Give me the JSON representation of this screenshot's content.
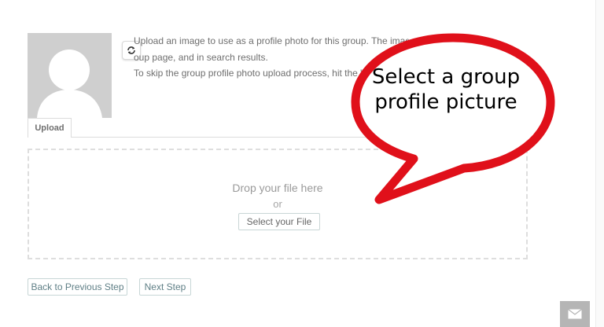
{
  "profile": {
    "intro_line1": "Upload an image to use as a profile photo for this group. The image",
    "intro_line2": "oup page, and in search results.",
    "skip_text": "To skip the group profile photo upload process, hit the \"N",
    "refresh_icon": "refresh-icon",
    "avatar_icon": "person-silhouette"
  },
  "tabs": {
    "upload_label": "Upload"
  },
  "dropzone": {
    "title": "Drop your file here",
    "or_text": "or",
    "select_button": "Select your File"
  },
  "actions": {
    "back_label": "Back to Previous Step",
    "next_label": "Next Step"
  },
  "callout": {
    "line1": "Select a group",
    "line2": "profile picture",
    "color": "#e0101a"
  },
  "footer": {
    "mail_icon": "envelope-icon"
  }
}
